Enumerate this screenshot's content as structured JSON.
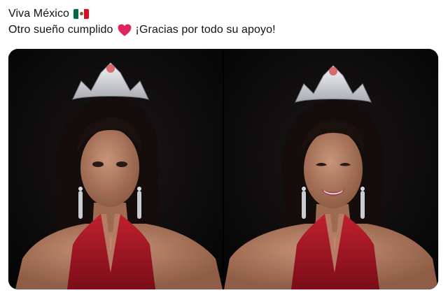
{
  "tweet": {
    "line1": "Viva México",
    "line2_before": "Otro sueño cumplido",
    "line2_after": "¡Gracias por todo su apoyo!",
    "flag_icon": "mexico-flag-icon",
    "heart_icon": "red-heart-icon"
  },
  "colors": {
    "flag_green": "#006847",
    "flag_white": "#ffffff",
    "flag_red": "#ce1126",
    "heart_red": "#e0245e",
    "dress_red": "#a81524",
    "background": "#0c0b0c"
  },
  "media": {
    "photos": [
      {
        "name": "photo-left",
        "expression": "neutral"
      },
      {
        "name": "photo-right",
        "expression": "smiling"
      }
    ]
  }
}
